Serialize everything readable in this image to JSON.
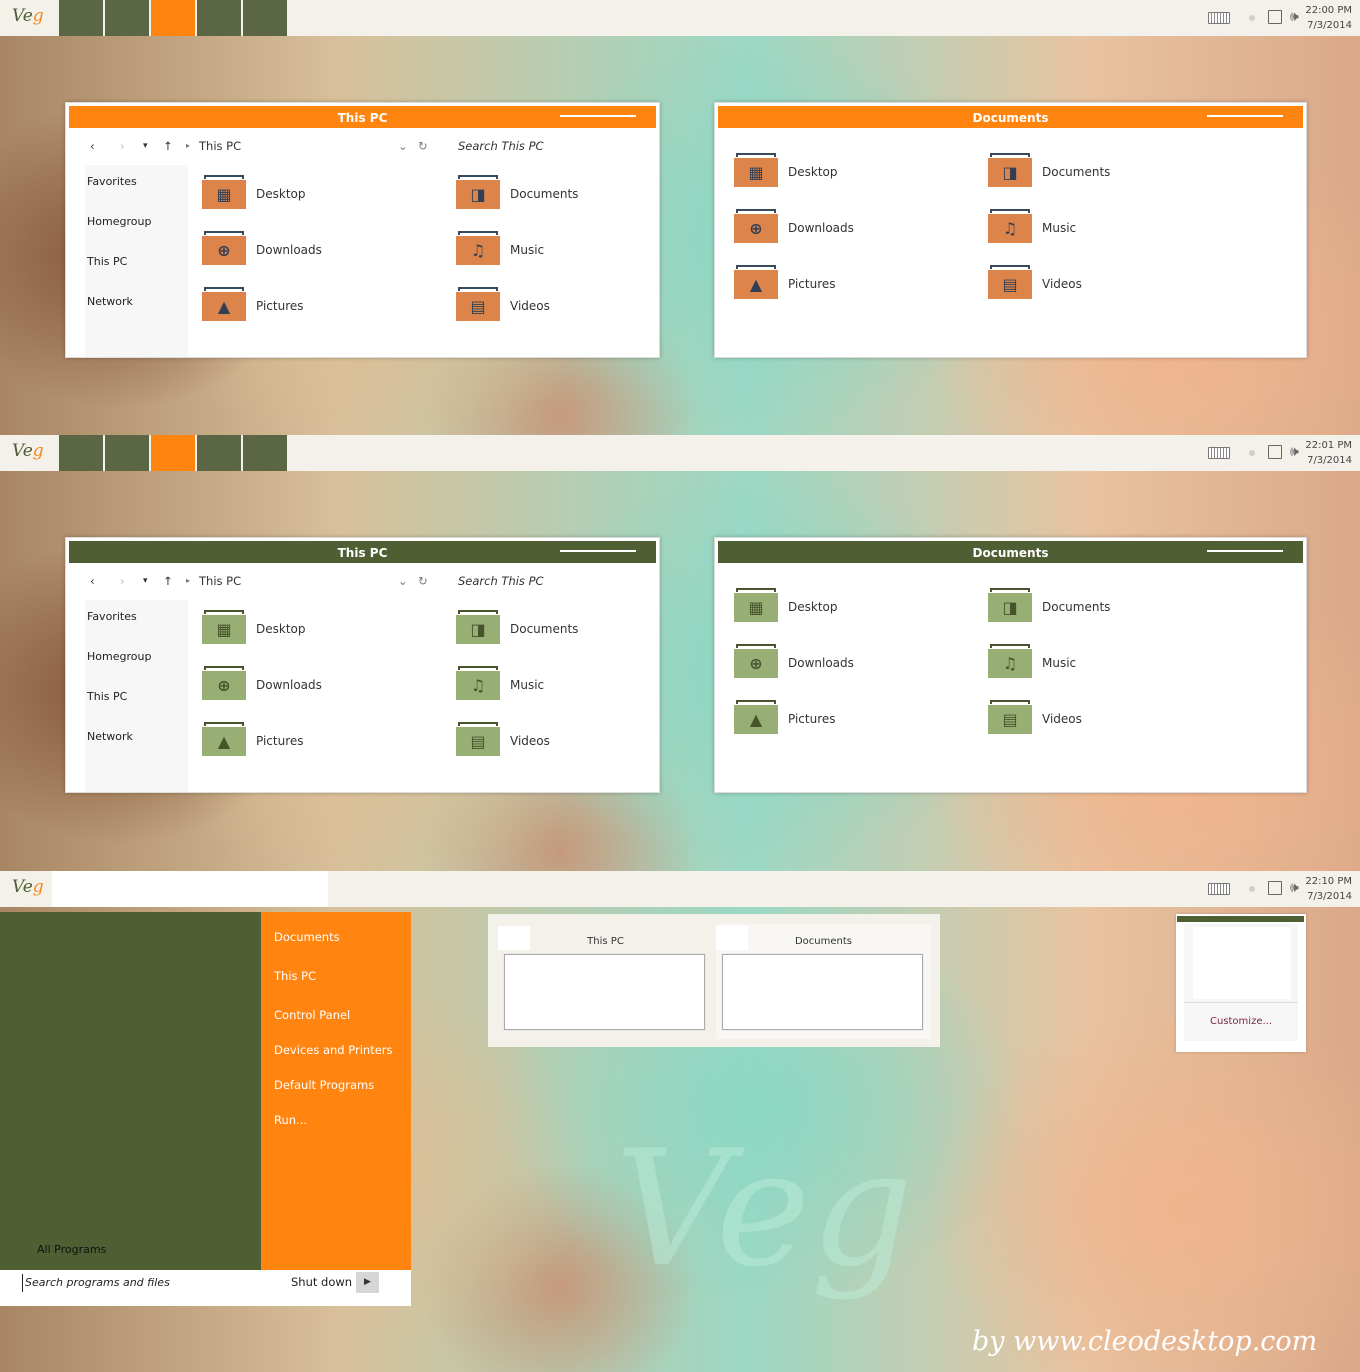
{
  "brand": {
    "logo_text_main": "Ve",
    "logo_text_accent": "g",
    "watermark": "Veg",
    "credit": "by www.cleodesktop.com"
  },
  "colors": {
    "orange": "#ff8410",
    "olive": "#505e33",
    "folder_orange": "#dc844a",
    "folder_green": "#97ae74",
    "taskbar": "#f3f1ea",
    "link": "#7a2845"
  },
  "taskbars": [
    {
      "time": "22:00 PM",
      "date": "7/3/2014",
      "active_task": 2
    },
    {
      "time": "22:01 PM",
      "date": "7/3/2014",
      "active_task": 2
    },
    {
      "time": "22:10 PM",
      "date": "7/3/2014"
    }
  ],
  "tray_icons": [
    "keyboard-icon",
    "status-dot-icon",
    "network-icon",
    "speaker-icon"
  ],
  "explorer": {
    "title": "This PC",
    "nav": {
      "back": "‹",
      "forward": "›",
      "recent": "▾",
      "up": "↑",
      "sep": "▸",
      "path": "This PC",
      "dropdown": "⌄",
      "refresh": "↻",
      "search_placeholder": "Search This PC"
    },
    "sidebar": [
      "Favorites",
      "Homegroup",
      "This PC",
      "Network"
    ],
    "folders": [
      {
        "label": "Desktop",
        "icon": "desktop-icon",
        "glyph": "▦"
      },
      {
        "label": "Documents",
        "icon": "document-icon",
        "glyph": "◨"
      },
      {
        "label": "Downloads",
        "icon": "download-icon",
        "glyph": "⊕"
      },
      {
        "label": "Music",
        "icon": "music-icon",
        "glyph": "♫"
      },
      {
        "label": "Pictures",
        "icon": "picture-icon",
        "glyph": "▲"
      },
      {
        "label": "Videos",
        "icon": "video-icon",
        "glyph": "▤"
      }
    ]
  },
  "documents_window": {
    "title": "Documents"
  },
  "start_menu": {
    "right_items": [
      "Documents",
      "This PC",
      "Control Panel",
      "Devices and Printers",
      "Default Programs",
      "Run..."
    ],
    "all_programs": "All Programs",
    "search_placeholder": "Search programs and files",
    "shutdown": "Shut down",
    "shutdown_arrow": "▶"
  },
  "taskbar_preview": [
    {
      "title": "This PC"
    },
    {
      "title": "Documents"
    }
  ],
  "notification": {
    "customize": "Customize..."
  }
}
